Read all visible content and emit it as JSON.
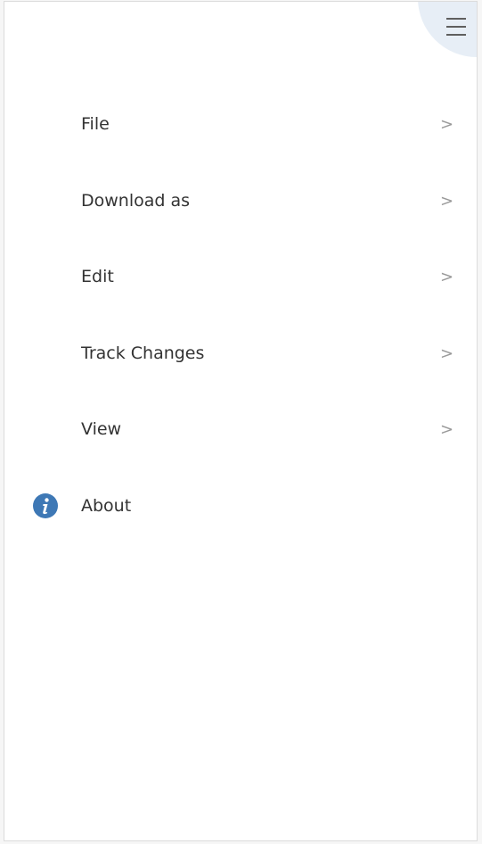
{
  "header": {
    "menu_button_icon": "hamburger-icon"
  },
  "menu": {
    "items": [
      {
        "label": "File",
        "chevron": ">"
      },
      {
        "label": "Download as",
        "chevron": ">"
      },
      {
        "label": "Edit",
        "chevron": ">"
      },
      {
        "label": "Track Changes",
        "chevron": ">"
      },
      {
        "label": "View",
        "chevron": ">"
      },
      {
        "label": "About",
        "icon": "info-icon"
      }
    ]
  },
  "colors": {
    "accent": "#3e78b5",
    "menu_button_bg": "#e7eef6",
    "text": "#333333",
    "chevron": "#9a9a9a"
  }
}
